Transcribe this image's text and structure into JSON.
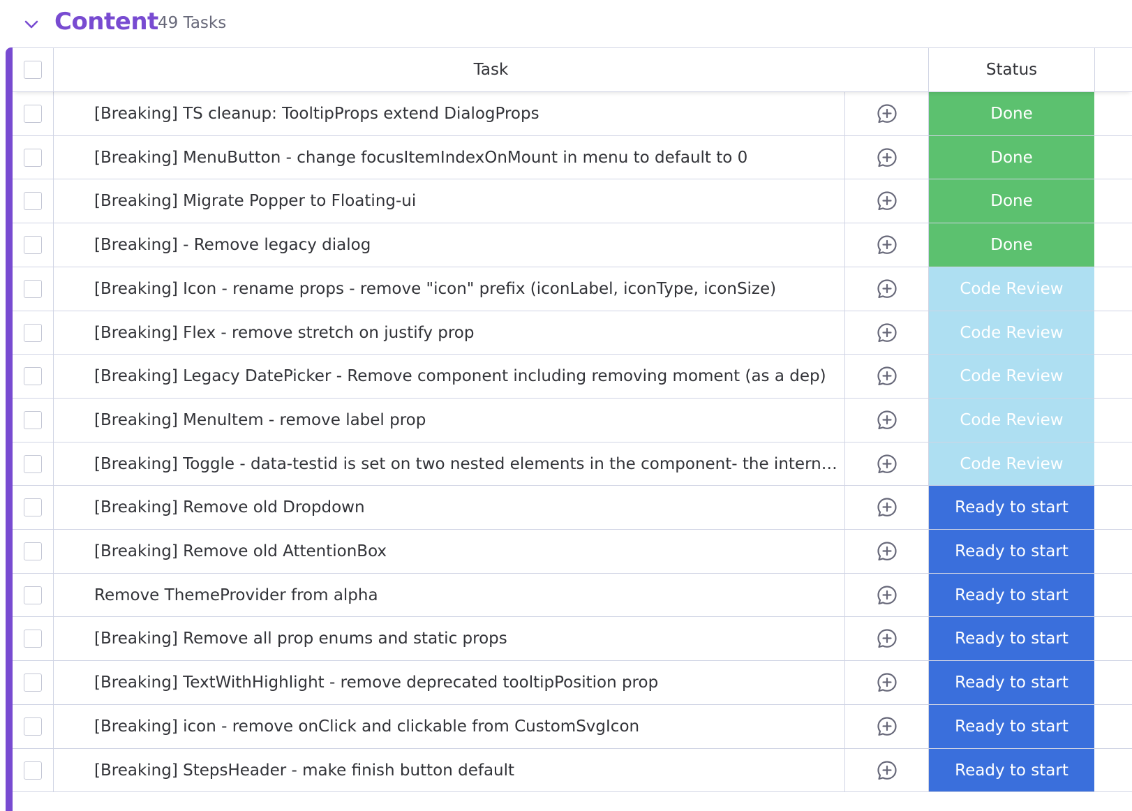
{
  "group": {
    "title": "Content",
    "count": "49 Tasks",
    "color": "#784bd1"
  },
  "columns": {
    "task": "Task",
    "status": "Status"
  },
  "status_colors": {
    "Done": "#5cc16f",
    "Code Review": "#aedff2",
    "Ready to start": "#3a6fdc"
  },
  "icons": {
    "collapse": "chevron-down-icon",
    "comment": "add-update-icon"
  },
  "rows": [
    {
      "task": "[Breaking] TS cleanup: TooltipProps extend DialogProps",
      "status": "Done"
    },
    {
      "task": "[Breaking] MenuButton - change focusItemIndexOnMount in menu to default to 0",
      "status": "Done"
    },
    {
      "task": "[Breaking] Migrate Popper to Floating-ui",
      "status": "Done"
    },
    {
      "task": "[Breaking] - Remove legacy dialog",
      "status": "Done"
    },
    {
      "task": "[Breaking] Icon - rename props - remove \"icon\" prefix (iconLabel, iconType, iconSize)",
      "status": "Code Review"
    },
    {
      "task": "[Breaking] Flex - remove stretch on justify prop",
      "status": "Code Review"
    },
    {
      "task": "[Breaking] Legacy DatePicker - Remove component including removing moment (as a dep)",
      "status": "Code Review"
    },
    {
      "task": "[Breaking] MenuItem - remove label prop",
      "status": "Code Review"
    },
    {
      "task": "[Breaking] Toggle - data-testid is set on two nested elements in the component- the internal on...",
      "status": "Code Review"
    },
    {
      "task": "[Breaking] Remove old Dropdown",
      "status": "Ready to start"
    },
    {
      "task": "[Breaking] Remove old AttentionBox",
      "status": "Ready to start"
    },
    {
      "task": "Remove ThemeProvider from alpha",
      "status": "Ready to start"
    },
    {
      "task": "[Breaking] Remove all prop enums and static props",
      "status": "Ready to start"
    },
    {
      "task": "[Breaking] TextWithHighlight - remove deprecated tooltipPosition prop",
      "status": "Ready to start"
    },
    {
      "task": "[Breaking] icon - remove onClick and clickable from CustomSvgIcon",
      "status": "Ready to start"
    },
    {
      "task": "[Breaking] StepsHeader - make finish button default",
      "status": "Ready to start"
    }
  ]
}
